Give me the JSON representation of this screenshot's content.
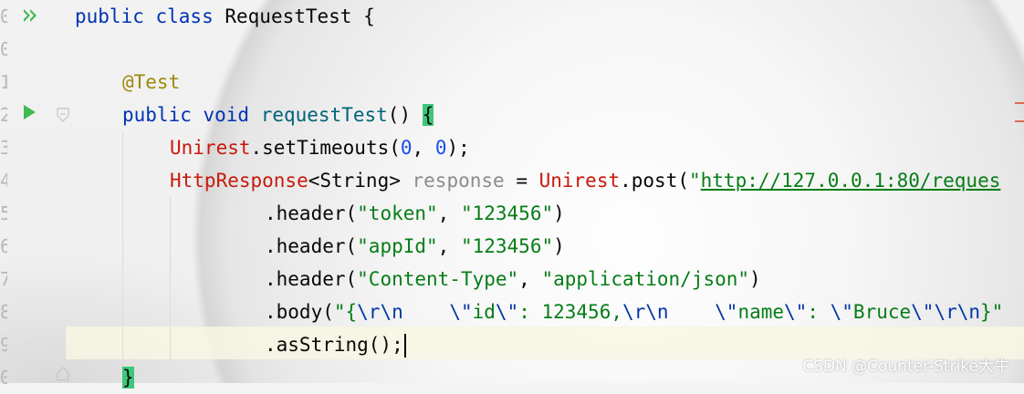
{
  "gutter": {
    "line_numbers": [
      "0",
      "0",
      "1",
      "2",
      "3",
      "4",
      "5",
      "6",
      "7",
      "8",
      "9",
      "0"
    ]
  },
  "code": {
    "l1": {
      "kw": "public class ",
      "name": "RequestTest",
      "rest": " {"
    },
    "l3": {
      "ann": "@Test"
    },
    "l4": {
      "kw": "public void ",
      "fn": "requestTest",
      "paren": "() ",
      "brace": "{"
    },
    "l5": {
      "cls": "Unirest",
      "m": ".setTimeouts(",
      "n1": "0",
      "sep": ", ",
      "n2": "0",
      "end": ");"
    },
    "l6": {
      "cls": "HttpResponse",
      "gen": "<String> ",
      "var": "response",
      "eq": " = ",
      "cls2": "Unirest",
      "m": ".post(",
      "q": "\"",
      "url": "http://127.0.0.1:80/reques"
    },
    "l7": {
      "m": ".header(",
      "s1": "\"token\"",
      "sep": ", ",
      "s2": "\"123456\"",
      "end": ")"
    },
    "l8": {
      "m": ".header(",
      "s1": "\"appId\"",
      "sep": ", ",
      "s2": "\"123456\"",
      "end": ")"
    },
    "l9": {
      "m": ".header(",
      "s1": "\"Content-Type\"",
      "sep": ", ",
      "s2": "\"application/json\"",
      "end": ")"
    },
    "l10": {
      "m": ".body(",
      "a": "\"{",
      "b": "\\r\\n",
      "c": "    ",
      "d": "\\\"",
      "e": "id",
      "f": "\\\"",
      "g": ": 123456,",
      "h": "\\r\\n",
      "i": "    ",
      "j": "\\\"",
      "k": "name",
      "l": "\\\"",
      "m2": ": ",
      "n": "\\\"",
      "o": "Bruce",
      "p": "\\\"",
      "q": "\\r\\n",
      "r": "}\""
    },
    "l11": {
      "m": ".asString();"
    },
    "l12": {
      "brace": "}"
    }
  },
  "watermark": "CSDN @Counter-Strike大牛",
  "colors": {
    "keyword": "#0033b3",
    "annotation": "#9e880d",
    "method": "#00627a",
    "class": "#c8190b",
    "number": "#1750eb",
    "string": "#067d17",
    "brace_highlight": "#3cc87a",
    "run_icon": "#3fb950"
  },
  "icons": [
    "run-all-icon",
    "run-icon",
    "fold-icon"
  ]
}
